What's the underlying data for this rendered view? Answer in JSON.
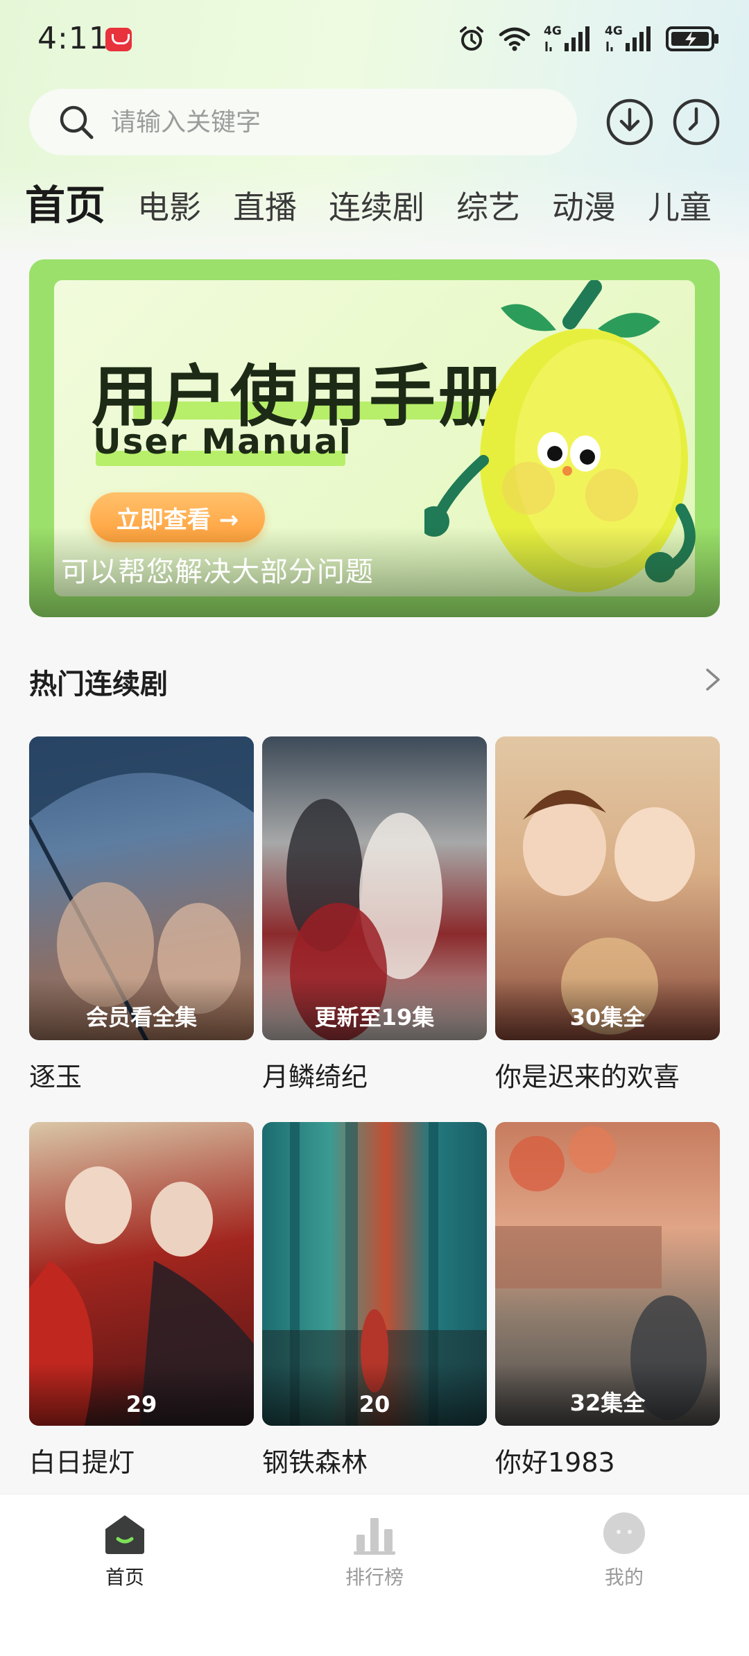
{
  "status_bar": {
    "time": "4:11",
    "signal_1_label": "4G",
    "signal_2_label": "4G"
  },
  "search": {
    "placeholder": "请输入关键字",
    "value": ""
  },
  "header_icons": [
    "download-icon",
    "history-icon"
  ],
  "tabs": [
    {
      "label": "首页",
      "active": true
    },
    {
      "label": "电影",
      "active": false
    },
    {
      "label": "直播",
      "active": false
    },
    {
      "label": "连续剧",
      "active": false
    },
    {
      "label": "综艺",
      "active": false
    },
    {
      "label": "动漫",
      "active": false
    },
    {
      "label": "儿童",
      "active": false
    }
  ],
  "banner": {
    "title": "用户使用手册",
    "subtitle": "User Manual",
    "cta": "立即查看 →",
    "caption": "可以帮您解决大部分问题"
  },
  "section": {
    "title": "热门连续剧"
  },
  "dramas": [
    {
      "title": "逐玉",
      "badge": "会员看全集"
    },
    {
      "title": "月鳞绮纪",
      "badge": "更新至19集"
    },
    {
      "title": "你是迟来的欢喜",
      "badge": "30集全"
    },
    {
      "title": "白日提灯",
      "badge": "29"
    },
    {
      "title": "钢铁森林",
      "badge": "20"
    },
    {
      "title": "你好1983",
      "badge": "32集全"
    }
  ],
  "bottom_nav": [
    {
      "label": "首页",
      "icon": "home-icon",
      "active": true
    },
    {
      "label": "排行榜",
      "icon": "ranking-icon",
      "active": false
    },
    {
      "label": "我的",
      "icon": "profile-icon",
      "active": false
    }
  ],
  "colors": {
    "accent_green": "#9be06a",
    "cta_orange": "#ff9f3b",
    "text_primary": "#1e1e1e"
  }
}
